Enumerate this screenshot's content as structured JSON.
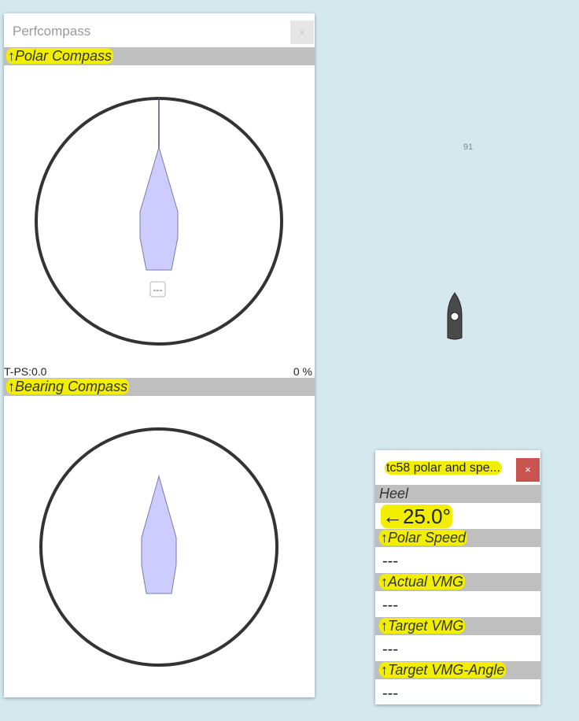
{
  "perfcompass": {
    "title": "Perfcompass",
    "close_label": "×",
    "polar_compass": {
      "label": "↑Polar Compass",
      "center_value": "---"
    },
    "footer_left": "T-PS:0.0",
    "footer_right": "0 %",
    "bearing_compass": {
      "label": "↑Bearing Compass"
    }
  },
  "map": {
    "label": "91"
  },
  "tc58": {
    "title": "tc58 polar and spe...",
    "close_label": "×",
    "rows": [
      {
        "label": "Heel",
        "value": "←25.0°"
      },
      {
        "label": "↑Polar Speed",
        "value": "---"
      },
      {
        "label": "↑Actual VMG",
        "value": "---"
      },
      {
        "label": "↑Target VMG",
        "value": "---"
      },
      {
        "label": "↑Target VMG-Angle",
        "value": "---"
      }
    ]
  },
  "colors": {
    "map_background": "#d4e8ee",
    "highlight": "#f2ee00",
    "boat_fill": "#ccccff",
    "close_red": "#c9534f",
    "section_bar": "#bfbfbf"
  }
}
